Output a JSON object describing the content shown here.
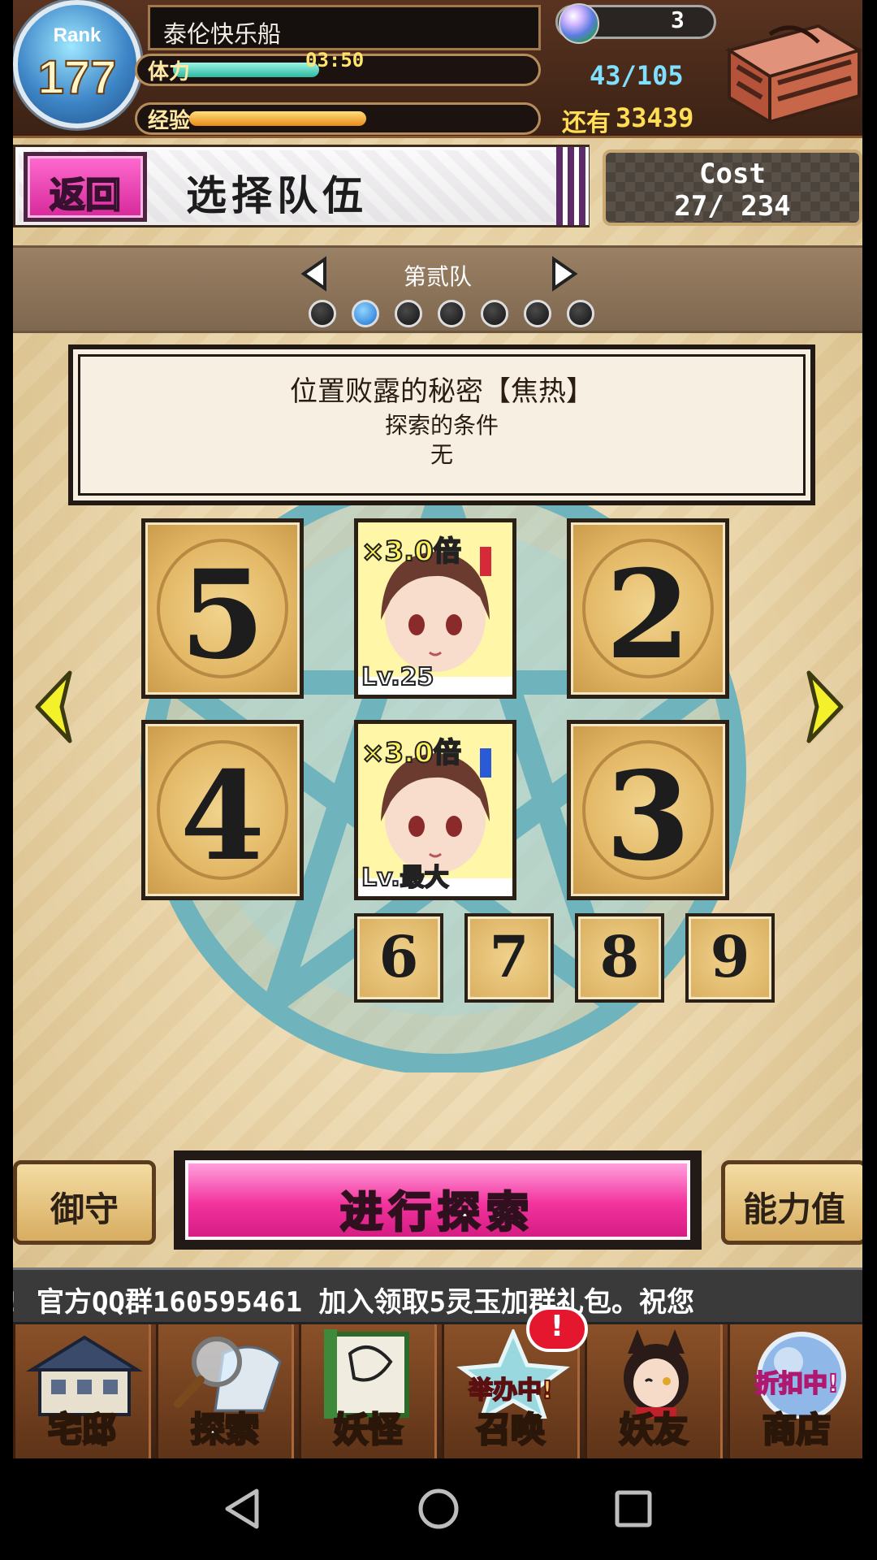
{
  "header": {
    "rank_label": "Rank",
    "rank_value": "177",
    "player_name": "泰伦快乐船",
    "stamina_label": "体力",
    "stamina_timer": "03:50",
    "stamina_current": "43/105",
    "stamina_fraction": 0.41,
    "exp_label": "经验",
    "exp_fraction": 0.52,
    "exp_remaining_label": "还有",
    "exp_remaining_value": "33439",
    "gem_count": "3"
  },
  "title_bar": {
    "back_label": "返回",
    "title": "选择队伍",
    "cost_label": "Cost",
    "cost_value": "27/ 234"
  },
  "team_selector": {
    "team_name": "第贰队",
    "page_count": 7,
    "active_page": 2
  },
  "mission": {
    "title": "位置败露的秘密【焦热】",
    "condition_label": "探索的条件",
    "condition_value": "无"
  },
  "slots": {
    "slot_5": "5",
    "slot_2": "2",
    "slot_4": "4",
    "slot_3": "3",
    "slot_6": "6",
    "slot_7": "7",
    "slot_8": "8",
    "slot_9": "9"
  },
  "characters": [
    {
      "multiplier": "×3.0倍",
      "level": "Lv.25"
    },
    {
      "multiplier": "×3.0倍",
      "level": "Lv.最大"
    }
  ],
  "actions": {
    "charm_label": "御守",
    "explore_label": "进行探索",
    "stats_label": "能力值"
  },
  "ticker": {
    "text": "! 官方QQ群160595461 加入领取5灵玉加群礼包。祝您"
  },
  "bottom_nav": {
    "home": "宅邸",
    "explore": "探索",
    "yokai": "妖怪",
    "summon": "召唤",
    "summon_badge": "举办中!",
    "friends": "妖友",
    "shop": "商店",
    "shop_badge": "折扣中!",
    "alert": "!"
  },
  "colors": {
    "accent_pink": "#f2339d",
    "stamina_fill": "#3fd3b8",
    "exp_fill": "#f5a623",
    "active_dot": "#1c6fd0"
  }
}
